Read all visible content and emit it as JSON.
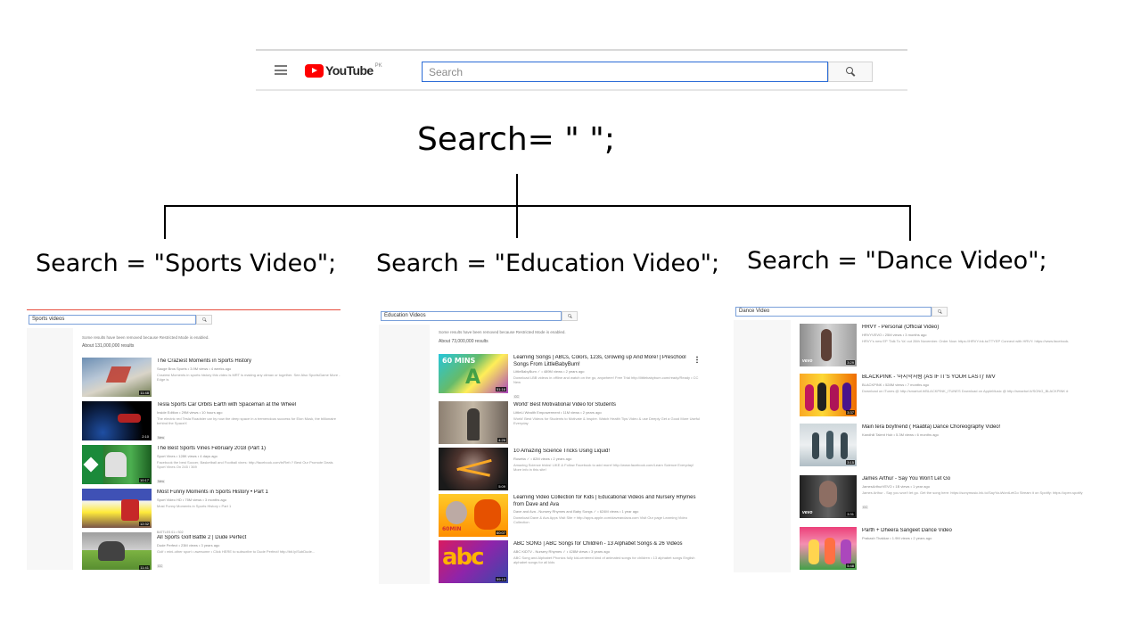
{
  "header": {
    "logo_text": "YouTube",
    "logo_region": "PK",
    "search_placeholder": "Search"
  },
  "tree": {
    "root_label": "Search= \" \";",
    "branches": [
      "Search = \"Sports Video\";",
      "Search = \"Education Video\";",
      "Search = \"Dance Video\";"
    ]
  },
  "panels": {
    "sports": {
      "query": "Sports videos",
      "notice": "Some results have been removed because Restricted Mode is enabled.",
      "about": "About 131,000,000 results",
      "results": [
        {
          "title": "The Craziest Moments in Sports History",
          "meta": "Sauge Bros Sports • 3.9M views • 4 weeks ago",
          "desc": "Craziest Moments in sports history this video is MRT is making any climax or together. See Also SportsGame More - Edge is",
          "tag": "",
          "dur": "11:48"
        },
        {
          "title": "Tesla Sports Car Orbits Earth with Spaceman at the Wheel",
          "meta": "Inside Edition • 29M views • 10 hours ago",
          "desc": "The electric red Tesla Roadster car by now the deep space in a tremendous success for Elon Musk, the billionaire behind the SpaceX",
          "tag": "New",
          "dur": "2:10"
        },
        {
          "title": "The Best Sports Vines February 2018 (Part 1)",
          "meta": "Sport Vines • 128K views • 4 days ago",
          "desc": "Facebook the best Soccer, Basketball and Football vines: http://facebook.com/tr/Ref=? Best Our Promote Deals Sport Vines On 245 / 369",
          "tag": "New",
          "dur": "10:17"
        },
        {
          "title": "Most Funny Moments in Sports History • Part 1",
          "meta": "Sport Video HD • 75M views • 3 months ago",
          "desc": "Most Funny Moments in Sports History • Part 1",
          "tag": "",
          "dur": "12:32"
        },
        {
          "title": "All Sports Golf Battle 2 | Dude Perfect",
          "meta": "Dude Perfect • 23M views • 3 years ago",
          "desc": "Golf • mini-other sport • awesome • Click HERE to subscribe to Dude Perfect! http://bit.ly/SubDude...",
          "tag": "CC",
          "dur": "11:41",
          "pre": "BATTLES 01 • S02"
        }
      ]
    },
    "education": {
      "query": "Education Videos",
      "notice": "Some results have been removed because Restricted Mode is enabled.",
      "about": "About 73,000,000 results",
      "results": [
        {
          "title": "Learning Songs | ABCs, Colors, 123s, Growing up And More! | Preschool Songs From LittleBabyBum!",
          "meta": "LittleBabyBum ✓ • 489M views • 2 years ago",
          "desc": "Download LBB videos in offline and watch on the go, anywhere! Free Trial http://littlebabybum.com/ready/Ready • CC New",
          "tag": "CC",
          "dur": "51:16"
        },
        {
          "title": "World' Best Motivational Video for Students",
          "meta": "LittleLi Wealth Empowerment • 11M views • 2 years ago",
          "desc": "World' Best Videos for Students to Motivate & Inspire. Watch Health Tips Video & use Deeply Get a Good More Useful Everyday",
          "tag": "",
          "dur": "4:26"
        },
        {
          "title": "10 Amazing Science Tricks Using Liquid!",
          "meta": "Rosetta ✓ • 82M views • 2 years ago",
          "desc": "Amazing Science tricks! LIKE & Follow Facebook to add more! http://www.facebook.com/Learn Science Everyday! More info in this site!",
          "tag": "",
          "dur": "5:09"
        },
        {
          "title": "Learning Video Collection for Kids | Educational Videos and Nursery Rhymes from Dave and Ava",
          "meta": "Dave and Ava - Nursery Rhymes and Baby Songs ✓ • 624M views • 1 year ago",
          "desc": "Download Dave & Ava Apps Visit Site » http://apps.apple.com/daveandava.com Visit Our page Learning Video Collection",
          "tag": "",
          "dur": "60:07"
        },
        {
          "title": "ABC SONG | ABC Songs for Children - 13 Alphabet Songs & 26 Videos",
          "meta": "ABC KiDTV - Nursery Rhymes ✓ • 428M views • 3 years ago",
          "desc": "ABC Song and Alphabet Phonics fully kid-centered kind of animated songs for children • 13 alphabet songs English alphabet songs for all kids",
          "tag": "",
          "dur": "59:13"
        }
      ]
    },
    "dance": {
      "query": "Dance Video",
      "results": [
        {
          "title": "HRVY - Personal (Official Video)",
          "meta": "HRVYVEVO • 25M views • 3 months ago",
          "desc": "HRVY's new EP 'Talk To Ya' out 26th November. Order Now: https://HRVY.lnk.to/TTYEP Connect with HRVY: https://www.facebook.",
          "tag": "",
          "dur": "3:29",
          "vevo": "vevo"
        },
        {
          "title": "BLACKPINK - '마지막처럼 (AS IF IT'S YOUR LAST)' M/V",
          "meta": "BLACKPINK • 528M views • 7 months ago",
          "desc": "Download on iTunes @ http://smarturl.it/BLACKPINK_ITUNES Download on AppleMusic @ http://smarturl.it/SONG_BLACKPINK #",
          "tag": "",
          "dur": "3:37",
          "vevo": ""
        },
        {
          "title": "Main tera boyfriend ( Raabta) Dance Choreography Video!",
          "meta": "Kandhili Talent Hub • 5.3M views • 6 months ago",
          "desc": "",
          "tag": "",
          "dur": "3:15",
          "vevo": ""
        },
        {
          "title": "James Arthur - Say You Won't Let Go",
          "meta": "JamesArthurVEVO • 1B views • 1 year ago",
          "desc": "James Arthur - Say you won't let go. Get the song here: https://sonymusic.lnk.to/SayYouWontLetGo Stream it on Spotify: https://open.spotify",
          "tag": "CC",
          "dur": "3:31",
          "vevo": "vevo"
        },
        {
          "title": "Parth + Dheera Sangeet Dance Video",
          "meta": "Prakash Thakkar • 1.9M views • 2 years ago",
          "desc": "",
          "tag": "",
          "dur": "5:48",
          "vevo": ""
        }
      ]
    }
  }
}
